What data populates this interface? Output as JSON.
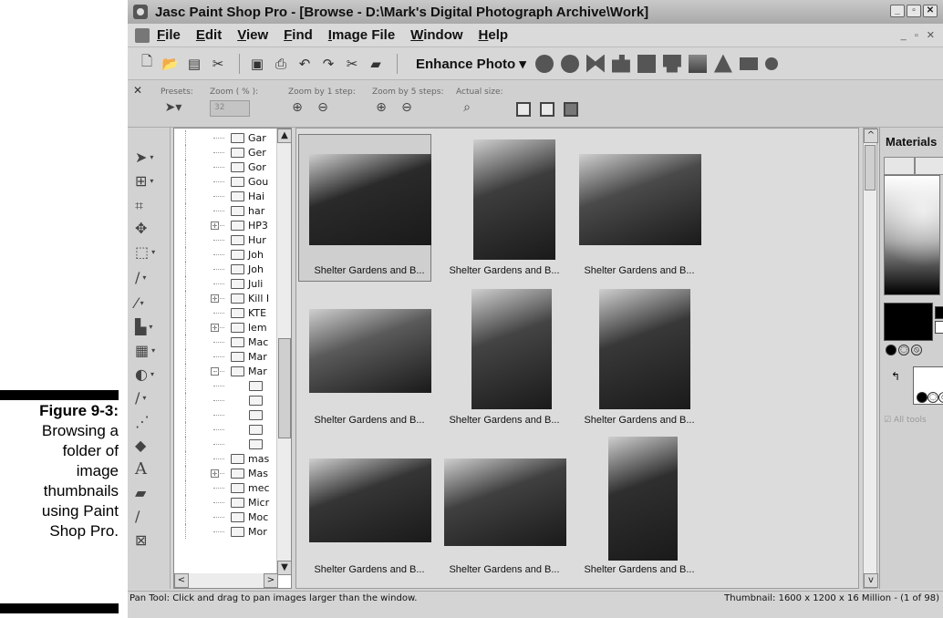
{
  "figure_caption": {
    "title": "Figure 9-3:",
    "lines": [
      "Browsing a",
      "folder of",
      "image",
      "thumbnails",
      "using Paint",
      "Shop Pro."
    ]
  },
  "window": {
    "title": "Jasc Paint Shop Pro - [Browse - D:\\Mark's Digital Photograph Archive\\Work]",
    "controls": [
      "_",
      "▫",
      "✕"
    ],
    "mdi_controls": "_ ▫ ✕"
  },
  "menu": {
    "items": [
      "File",
      "Edit",
      "View",
      "Find",
      "Image File",
      "Window",
      "Help"
    ]
  },
  "toolbar": {
    "enhance_label": "Enhance Photo",
    "enhance_arrow": "▾",
    "buttons": [
      "new-icon",
      "open-icon",
      "browse-icon",
      "scan-icon",
      "save-icon",
      "print-icon",
      "undo-icon",
      "redo-icon",
      "cut-icon",
      "paste-icon"
    ]
  },
  "tool_options": {
    "close": "✕",
    "presets_label": "Presets:",
    "zoom_percent_label": "Zoom ( % ):",
    "zoom_value": "32",
    "zoom_step1_label": "Zoom by 1 step:",
    "zoom_step5_label": "Zoom by 5 steps:",
    "actual_size_label": "Actual size:"
  },
  "tools": [
    "pan-icon",
    "zoom-icon",
    "crop-icon",
    "move-icon",
    "selection-icon",
    "dropper-icon",
    "straighten-icon",
    "red-eye-icon",
    "paint-brush-icon",
    "clone-icon",
    "eraser-icon",
    "airbrush-icon",
    "fill-icon",
    "text-icon",
    "shape-icon",
    "pen-icon",
    "warp-icon"
  ],
  "tree": {
    "folders": [
      {
        "name": "Gar",
        "expand": ""
      },
      {
        "name": "Ger",
        "expand": ""
      },
      {
        "name": "Gor",
        "expand": ""
      },
      {
        "name": "Gou",
        "expand": ""
      },
      {
        "name": "Hai",
        "expand": ""
      },
      {
        "name": "har",
        "expand": ""
      },
      {
        "name": "HP3",
        "expand": "+"
      },
      {
        "name": "Hur",
        "expand": ""
      },
      {
        "name": "Joh",
        "expand": ""
      },
      {
        "name": "Joh",
        "expand": ""
      },
      {
        "name": "Juli",
        "expand": ""
      },
      {
        "name": "Kill I",
        "expand": "+"
      },
      {
        "name": "KTE",
        "expand": ""
      },
      {
        "name": "lem",
        "expand": "+"
      },
      {
        "name": "Mac",
        "expand": ""
      },
      {
        "name": "Mar",
        "expand": ""
      },
      {
        "name": "Mar",
        "expand": "-"
      },
      {
        "name": "",
        "expand": ""
      },
      {
        "name": "",
        "expand": ""
      },
      {
        "name": "",
        "expand": ""
      },
      {
        "name": "",
        "expand": ""
      },
      {
        "name": "",
        "expand": ""
      },
      {
        "name": "mas",
        "expand": ""
      },
      {
        "name": "Mas",
        "expand": "+"
      },
      {
        "name": "mec",
        "expand": ""
      },
      {
        "name": "Micr",
        "expand": ""
      },
      {
        "name": "Moc",
        "expand": ""
      },
      {
        "name": "Mor",
        "expand": ""
      }
    ],
    "scroll_left": "<",
    "scroll_right": ">"
  },
  "thumbnails": {
    "items": [
      {
        "label": "Shelter Gardens and B...",
        "selected": true,
        "tone": "#2a2a2a"
      },
      {
        "label": "Shelter Gardens and B...",
        "selected": false,
        "tone": "#3d3d3d"
      },
      {
        "label": "Shelter Gardens and B...",
        "selected": false,
        "tone": "#4a4a4a"
      },
      {
        "label": "Shelter Gardens and B...",
        "selected": false,
        "tone": "#5a5a5a"
      },
      {
        "label": "Shelter Gardens and B...",
        "selected": false,
        "tone": "#444444"
      },
      {
        "label": "Shelter Gardens and B...",
        "selected": false,
        "tone": "#383838"
      },
      {
        "label": "Shelter Gardens and B...",
        "selected": false,
        "tone": "#353535"
      },
      {
        "label": "Shelter Gardens and B...",
        "selected": false,
        "tone": "#404040"
      },
      {
        "label": "Shelter Gardens and B...",
        "selected": false,
        "tone": "#2f2f2f"
      }
    ],
    "scroll_up": "^",
    "scroll_down": "v"
  },
  "materials": {
    "title": "Materials",
    "close": "✕",
    "all_tools_label": "All tools"
  },
  "status": {
    "left": "Pan Tool: Click and drag to pan images larger than the window.",
    "right": "Thumbnail: 1600 x 1200 x 16 Million - (1 of 98)"
  }
}
